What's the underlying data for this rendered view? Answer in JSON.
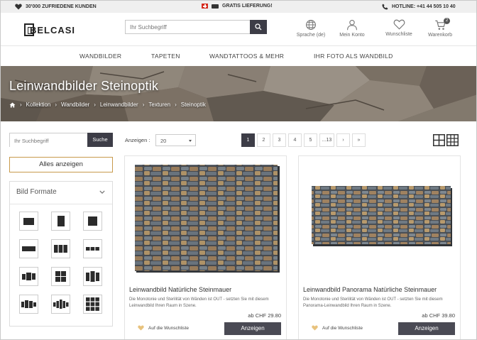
{
  "topbar": {
    "customers": "30'000 ZUFRIEDENE KUNDEN",
    "delivery": "GRATIS LIEFERUNG!",
    "hotline": "HOTLINE: +41 44 505 10 40"
  },
  "header": {
    "logo": "BELCASI",
    "search_placeholder": "Ihr Suchbegriff",
    "language": "Sprache (de)",
    "account": "Mein Konto",
    "wishlist": "Wunschliste",
    "cart": "Warenkorb",
    "cart_count": "2"
  },
  "nav": {
    "items": [
      "WANDBILDER",
      "TAPETEN",
      "WANDTATTOOS & MEHR",
      "IHR FOTO ALS WANDBILD"
    ]
  },
  "hero": {
    "title": "Leinwandbilder Steinoptik",
    "breadcrumb": [
      "Kollektion",
      "Wandbilder",
      "Leinwandbilder",
      "Texturen",
      "Steinoptik"
    ]
  },
  "sidebar": {
    "search_placeholder": "Ihr Suchbegriff",
    "search_button": "Suche",
    "show_all": "Alles anzeigen",
    "formats_title": "Bild Formate"
  },
  "toolbar": {
    "show_label": "Anzeigen :",
    "show_value": "20",
    "pages": [
      "1",
      "2",
      "3",
      "4",
      "5",
      "...13",
      "›",
      "»"
    ],
    "current_page": "1"
  },
  "products": [
    {
      "title": "Leinwandbild Natürliche Steinmauer",
      "description": "Die Monotonie und Sterilität von Wänden ist OUT - setzten Sie mit diesem Leinwandbild Ihren Raum in Szene.",
      "price": "ab CHF 29.80",
      "wishlist": "Auf die Wunschliste",
      "button": "Anzeigen"
    },
    {
      "title": "Leinwandbild Panorama Natürliche Steinmauer",
      "description": "Die Monotonie und Sterilität von Wänden ist OUT - setzten Sie mit diesem Panorama-Leinwandbild Ihren Raum in Szene.",
      "price": "ab CHF 39.80",
      "wishlist": "Auf die Wunschliste",
      "button": "Anzeigen"
    }
  ],
  "colors": {
    "dark_button": "#3d3d47",
    "accent_border": "#c89a4c",
    "heart": "#e8c27d",
    "topbar_bg": "#efefef"
  }
}
